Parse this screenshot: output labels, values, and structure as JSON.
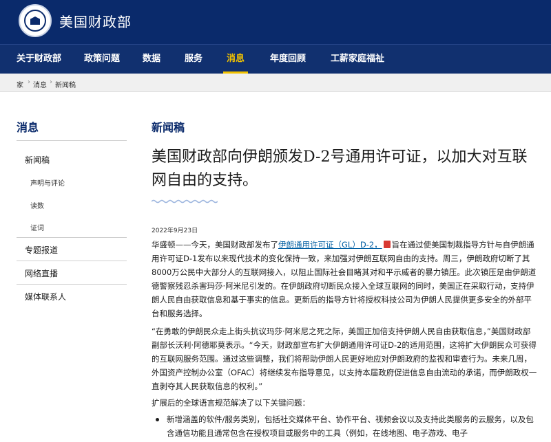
{
  "site": {
    "title": "美国财政部"
  },
  "nav": {
    "items": [
      {
        "label": "关于财政部"
      },
      {
        "label": "政策问题"
      },
      {
        "label": "数据"
      },
      {
        "label": "服务"
      },
      {
        "label": "消息"
      },
      {
        "label": "年度回顾"
      },
      {
        "label": "工薪家庭福祉"
      }
    ],
    "active": "消息"
  },
  "breadcrumb": [
    "家",
    "消息",
    "新闻稿"
  ],
  "sidebar": {
    "title": "消息",
    "items": [
      {
        "label": "新闻稿"
      },
      {
        "label": "声明与评论"
      },
      {
        "label": "读数"
      },
      {
        "label": "证词"
      },
      {
        "label": "专题报道"
      },
      {
        "label": "网络直播"
      },
      {
        "label": "媒体联系人"
      }
    ]
  },
  "article": {
    "section": "新闻稿",
    "headline": "美国财政部向伊朗颁发D-2号通用许可证，以加大对互联网自由的支持。",
    "date": "2022年9月23日",
    "p1_before_link": "华盛顿——今天，美国财政部发布了",
    "p1_link": "伊朗通用许可证（GL）D-2，",
    "p1_after_link": "旨在通过使美国制裁指导方针与自伊朗通用许可证D-1发布以来现代技术的变化保持一致，来加强对伊朗互联网自由的支持。周三，伊朗政府切断了其8000万公民中大部分人的互联网接入，以阻止国际社会目睹其对和平示威者的暴力镇压。此次镇压是由伊朗道德警察残忍杀害玛莎·阿米尼引发的。在伊朗政府切断民众接入全球互联网的同时，美国正在采取行动，支持伊朗人民自由获取信息和基于事实的信息。更新后的指导方针将授权科技公司为伊朗人民提供更多安全的外部平台和服务选择。",
    "p2": "“在勇敢的伊朗民众走上街头抗议玛莎·阿米尼之死之际，美国正加倍支持伊朗人民自由获取信息，”美国财政部副部长沃利·阿德耶莫表示。“今天，财政部宣布扩大伊朗通用许可证D-2的适用范围，这将扩大伊朗民众可获得的互联网服务范围。通过这些调整，我们将帮助伊朗人民更好地应对伊朗政府的监视和审查行为。未来几周，外国资产控制办公室（OFAC）将继续发布指导意见，以支持本届政府促进信息自由流动的承诺，而伊朗政权一直剥夺其人民获取信息的权利。”",
    "p3": "扩展后的全球语言规范解决了以下关键问题：",
    "bullets": [
      "新增涵盖的软件/服务类别，包括社交媒体平台、协作平台、视频会议以及支持此类服务的云服务，以及包含通信功能且通常包含在授权项目或服务中的工具（例如，在线地图、电子游戏、电子"
    ]
  },
  "colors": {
    "header": "#0a2a6b",
    "nav": "#11306f",
    "accent": "#f2c200",
    "link": "#005ea2"
  },
  "icons": {
    "seal": "treasury-seal-icon",
    "pdf": "pdf-icon"
  }
}
